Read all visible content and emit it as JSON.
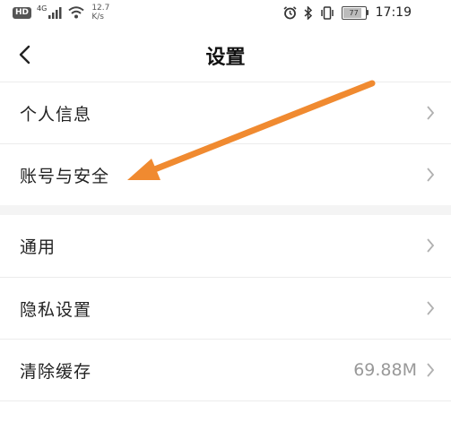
{
  "status_bar": {
    "hd": "HD",
    "network_type": "4G",
    "speed_value": "12.7",
    "speed_unit": "K/s",
    "battery_level": "77",
    "time": "17:19"
  },
  "header": {
    "title": "设置"
  },
  "group1": [
    {
      "label": "个人信息"
    },
    {
      "label": "账号与安全"
    }
  ],
  "group2": [
    {
      "label": "通用"
    },
    {
      "label": "隐私设置"
    },
    {
      "label": "清除缓存",
      "value": "69.88M"
    }
  ],
  "annotation": {
    "arrow_color": "#f08a30",
    "points_to": "账号与安全"
  }
}
